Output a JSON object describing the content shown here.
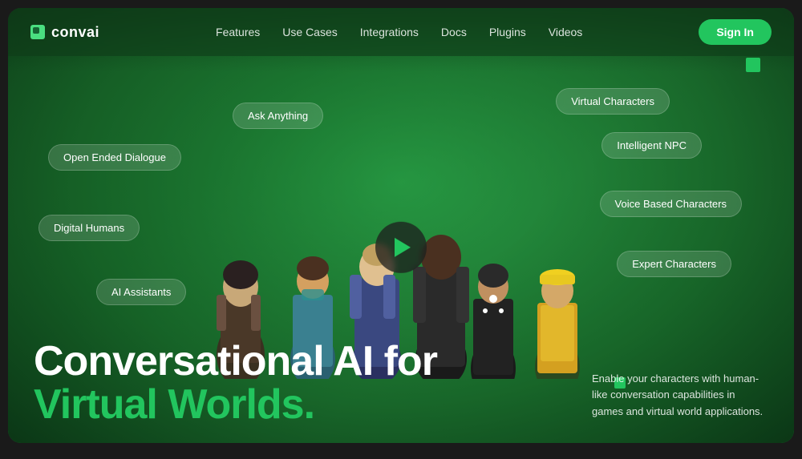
{
  "nav": {
    "logo_text": "convai",
    "links": [
      "Features",
      "Use Cases",
      "Integrations",
      "Docs",
      "Plugins",
      "Videos"
    ],
    "sign_in": "Sign In"
  },
  "tags": {
    "ask_anything": "Ask Anything",
    "virtual_characters": "Virtual Characters",
    "open_ended_dialogue": "Open Ended Dialogue",
    "intelligent_npc": "Intelligent NPC",
    "digital_humans": "Digital Humans",
    "voice_based": "Voice Based Characters",
    "ai_assistants": "AI Assistants",
    "expert_characters": "Expert Characters"
  },
  "hero": {
    "title_line1": "Conversational AI for",
    "title_line2": "Virtual Worlds.",
    "description": "Enable your characters with human-like conversation capabilities in games and virtual world applications."
  }
}
